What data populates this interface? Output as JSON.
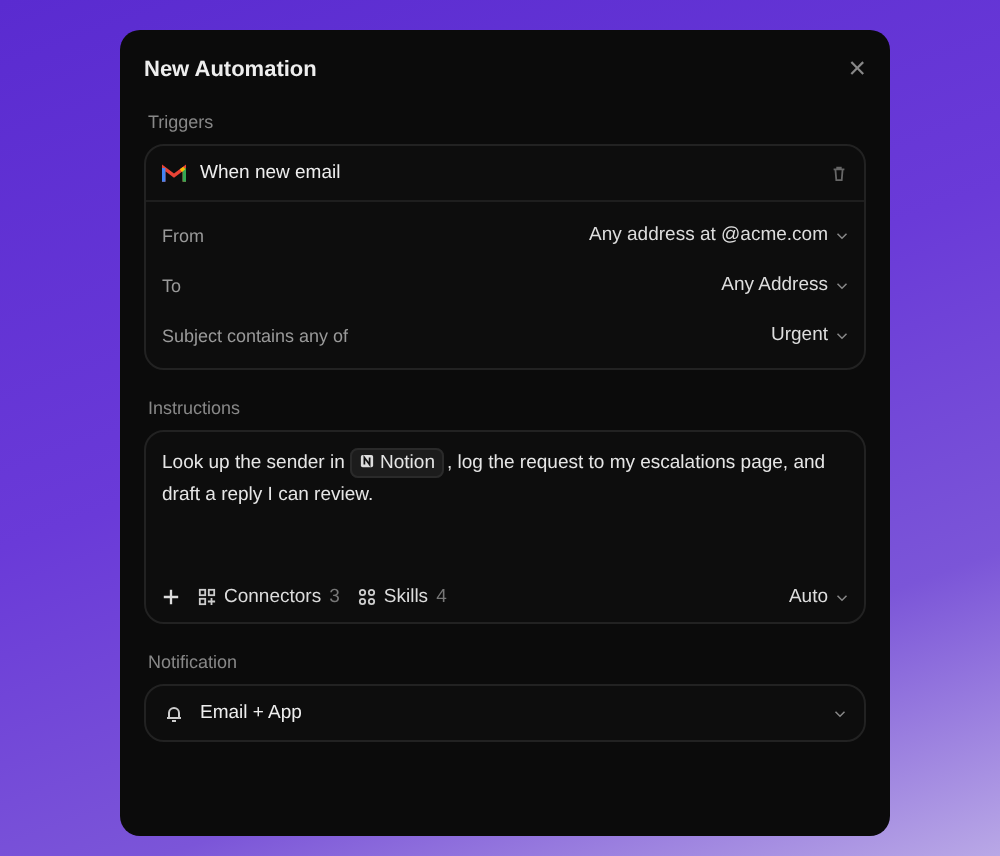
{
  "dialog": {
    "title": "New Automation",
    "close": "×"
  },
  "triggers": {
    "label": "Triggers",
    "app": "When new email",
    "conditions": [
      {
        "label": "From",
        "value": "Any address at @acme.com"
      },
      {
        "label": "To",
        "value": "Any Address"
      },
      {
        "label": "Subject contains any of",
        "value": "Urgent"
      }
    ]
  },
  "instructions": {
    "label": "Instructions",
    "text_before": "Look up the sender in",
    "mention": "Notion",
    "text_after": ", log the request to my escalations page, and draft a reply I can review.",
    "tools": [
      {
        "kind": "connectors",
        "label": "Connectors",
        "count": "3"
      },
      {
        "kind": "skills",
        "label": "Skills",
        "count": "4"
      }
    ],
    "model": "Auto"
  },
  "notification": {
    "label": "Notification",
    "value": "Email + App"
  }
}
